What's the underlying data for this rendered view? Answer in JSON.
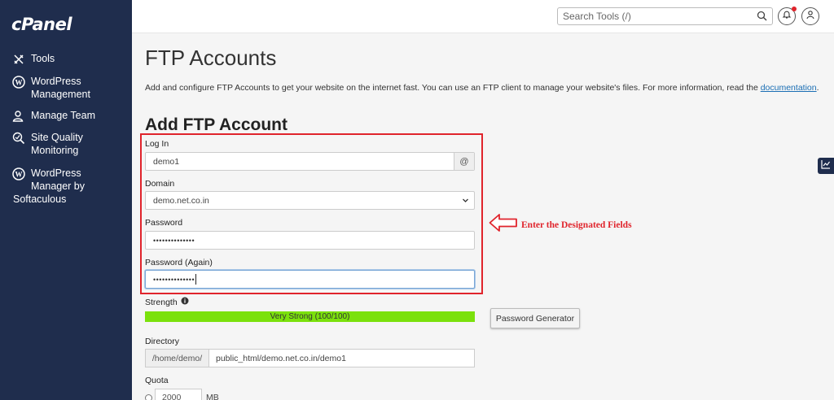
{
  "sidebar": {
    "logo": "cPanel",
    "items": [
      {
        "label": "Tools",
        "icon": "tools-icon"
      },
      {
        "label": "WordPress\nManagement",
        "icon": "wordpress-icon"
      },
      {
        "label": "Manage Team",
        "icon": "team-icon"
      },
      {
        "label": "Site Quality\nMonitoring",
        "icon": "site-quality-icon"
      },
      {
        "label": "WordPress\nManager by",
        "label2": "Softaculous",
        "icon": "wordpress-icon"
      }
    ]
  },
  "topbar": {
    "search_placeholder": "Search Tools (/)",
    "search_icon": "search-icon",
    "notification_icon": "bell-icon",
    "user_icon": "user-icon"
  },
  "page": {
    "title": "FTP Accounts",
    "description": "Add and configure FTP Accounts to get your website on the internet fast. You can use an FTP client to manage your website's files. For more information, read the ",
    "description_link": "documentation",
    "description_end": "."
  },
  "form": {
    "section_title": "Add FTP Account",
    "login_label": "Log In",
    "login_value": "demo1",
    "login_addon": "@",
    "domain_label": "Domain",
    "domain_value": "demo.net.co.in",
    "password_label": "Password",
    "password_value": "••••••••••••••",
    "password_again_label": "Password (Again)",
    "password_again_value": "••••••••••••••",
    "strength_label": "Strength",
    "strength_text": "Very Strong (100/100)",
    "strength_fraction": 1.0,
    "password_generator_label": "Password Generator",
    "directory_label": "Directory",
    "directory_prefix": "/home/demo/",
    "directory_value": "public_html/demo.net.co.in/demo1",
    "quota_label": "Quota",
    "quota_value": "2000",
    "quota_unit": "MB"
  },
  "annotation": {
    "text": "Enter the Designated Fields"
  },
  "colors": {
    "sidebar_bg": "#1f2d4d",
    "accent_red": "#e0242c",
    "strength_green": "#7be10c",
    "link_blue": "#1a6eb4"
  }
}
